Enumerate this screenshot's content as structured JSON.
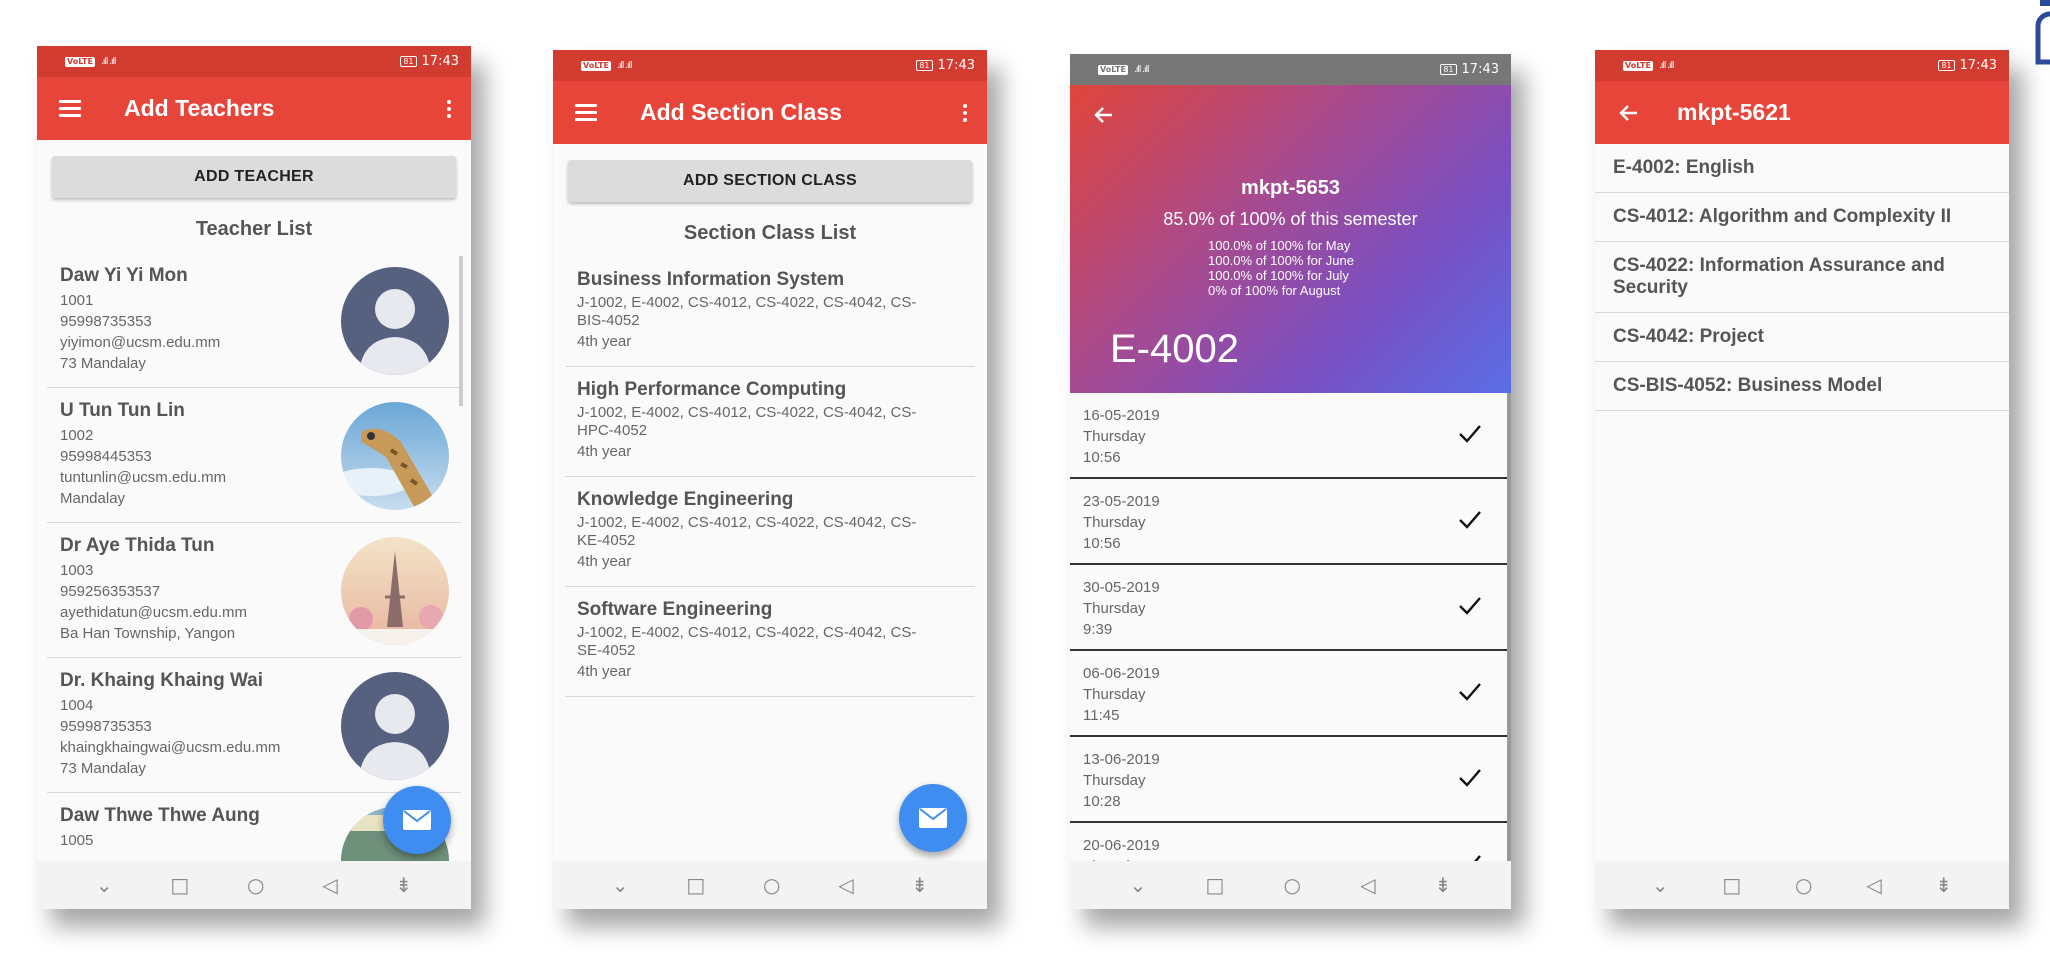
{
  "status_bar": {
    "time": "17:43",
    "volte": "VoLTE",
    "battery": "81"
  },
  "screen1": {
    "title": "Add Teachers",
    "button": "ADD TEACHER",
    "list_title": "Teacher List",
    "teachers": [
      {
        "name": "Daw Yi Yi Mon",
        "id": "1001",
        "phone": "95998735353",
        "email": "yiyimon@ucsm.edu.mm",
        "address": "73 Mandalay",
        "avatar": "default-avatar"
      },
      {
        "name": "U Tun Tun Lin",
        "id": "1002",
        "phone": "95998445353",
        "email": "tuntunlin@ucsm.edu.mm",
        "address": "Mandalay",
        "avatar": "giraffe-photo"
      },
      {
        "name": "Dr Aye Thida Tun",
        "id": "1003",
        "phone": "959256353537",
        "email": "ayethidatun@ucsm.edu.mm",
        "address": "Ba Han Township, Yangon",
        "avatar": "eiffel-photo"
      },
      {
        "name": "Dr. Khaing Khaing Wai",
        "id": "1004",
        "phone": "95998735353",
        "email": "khaingkhaingwai@ucsm.edu.mm",
        "address": "73 Mandalay",
        "avatar": "default-avatar"
      },
      {
        "name": "Daw Thwe Thwe Aung",
        "id": "1005",
        "phone": "",
        "email": "",
        "address": "",
        "avatar": "building-photo"
      }
    ]
  },
  "screen2": {
    "title": "Add Section Class",
    "button": "ADD SECTION CLASS",
    "list_title": "Section Class List",
    "sections": [
      {
        "name": "Business Information System",
        "codes": "J-1002, E-4002, CS-4012, CS-4022, CS-4042, CS-BIS-4052",
        "year": "4th year"
      },
      {
        "name": "High Performance Computing",
        "codes": "J-1002, E-4002, CS-4012, CS-4022, CS-4042, CS-HPC-4052",
        "year": "4th year"
      },
      {
        "name": "Knowledge Engineering",
        "codes": "J-1002, E-4002, CS-4012, CS-4022, CS-4042, CS-KE-4052",
        "year": "4th year"
      },
      {
        "name": "Software Engineering",
        "codes": "J-1002, E-4002, CS-4012, CS-4022, CS-4042, CS-SE-4052",
        "year": "4th year"
      }
    ]
  },
  "screen3": {
    "student_id": "mkpt-5653",
    "semester": "85.0% of 100% of this semester",
    "months": [
      "100.0% of 100% for May",
      "100.0% of 100% for June",
      "100.0% of 100% for July",
      "0% of 100% for August"
    ],
    "course": "E-4002",
    "attendance": [
      {
        "date": "16-05-2019",
        "day": "Thursday",
        "time": "10:56"
      },
      {
        "date": "23-05-2019",
        "day": "Thursday",
        "time": "10:56"
      },
      {
        "date": "30-05-2019",
        "day": "Thursday",
        "time": "9:39"
      },
      {
        "date": "06-06-2019",
        "day": "Thursday",
        "time": "11:45"
      },
      {
        "date": "13-06-2019",
        "day": "Thursday",
        "time": "10:28"
      },
      {
        "date": "20-06-2019",
        "day": "Thursday",
        "time": ""
      }
    ]
  },
  "screen4": {
    "title": "mkpt-5621",
    "courses": [
      "E-4002: English",
      "CS-4012: Algorithm and Complexity II",
      "CS-4022: Information Assurance and Security",
      "CS-4042: Project",
      "CS-BIS-4052: Business Model"
    ]
  },
  "colors": {
    "appbar": "#e8453a",
    "statusbar": "#d23b2f",
    "fab": "#3f8df0"
  }
}
